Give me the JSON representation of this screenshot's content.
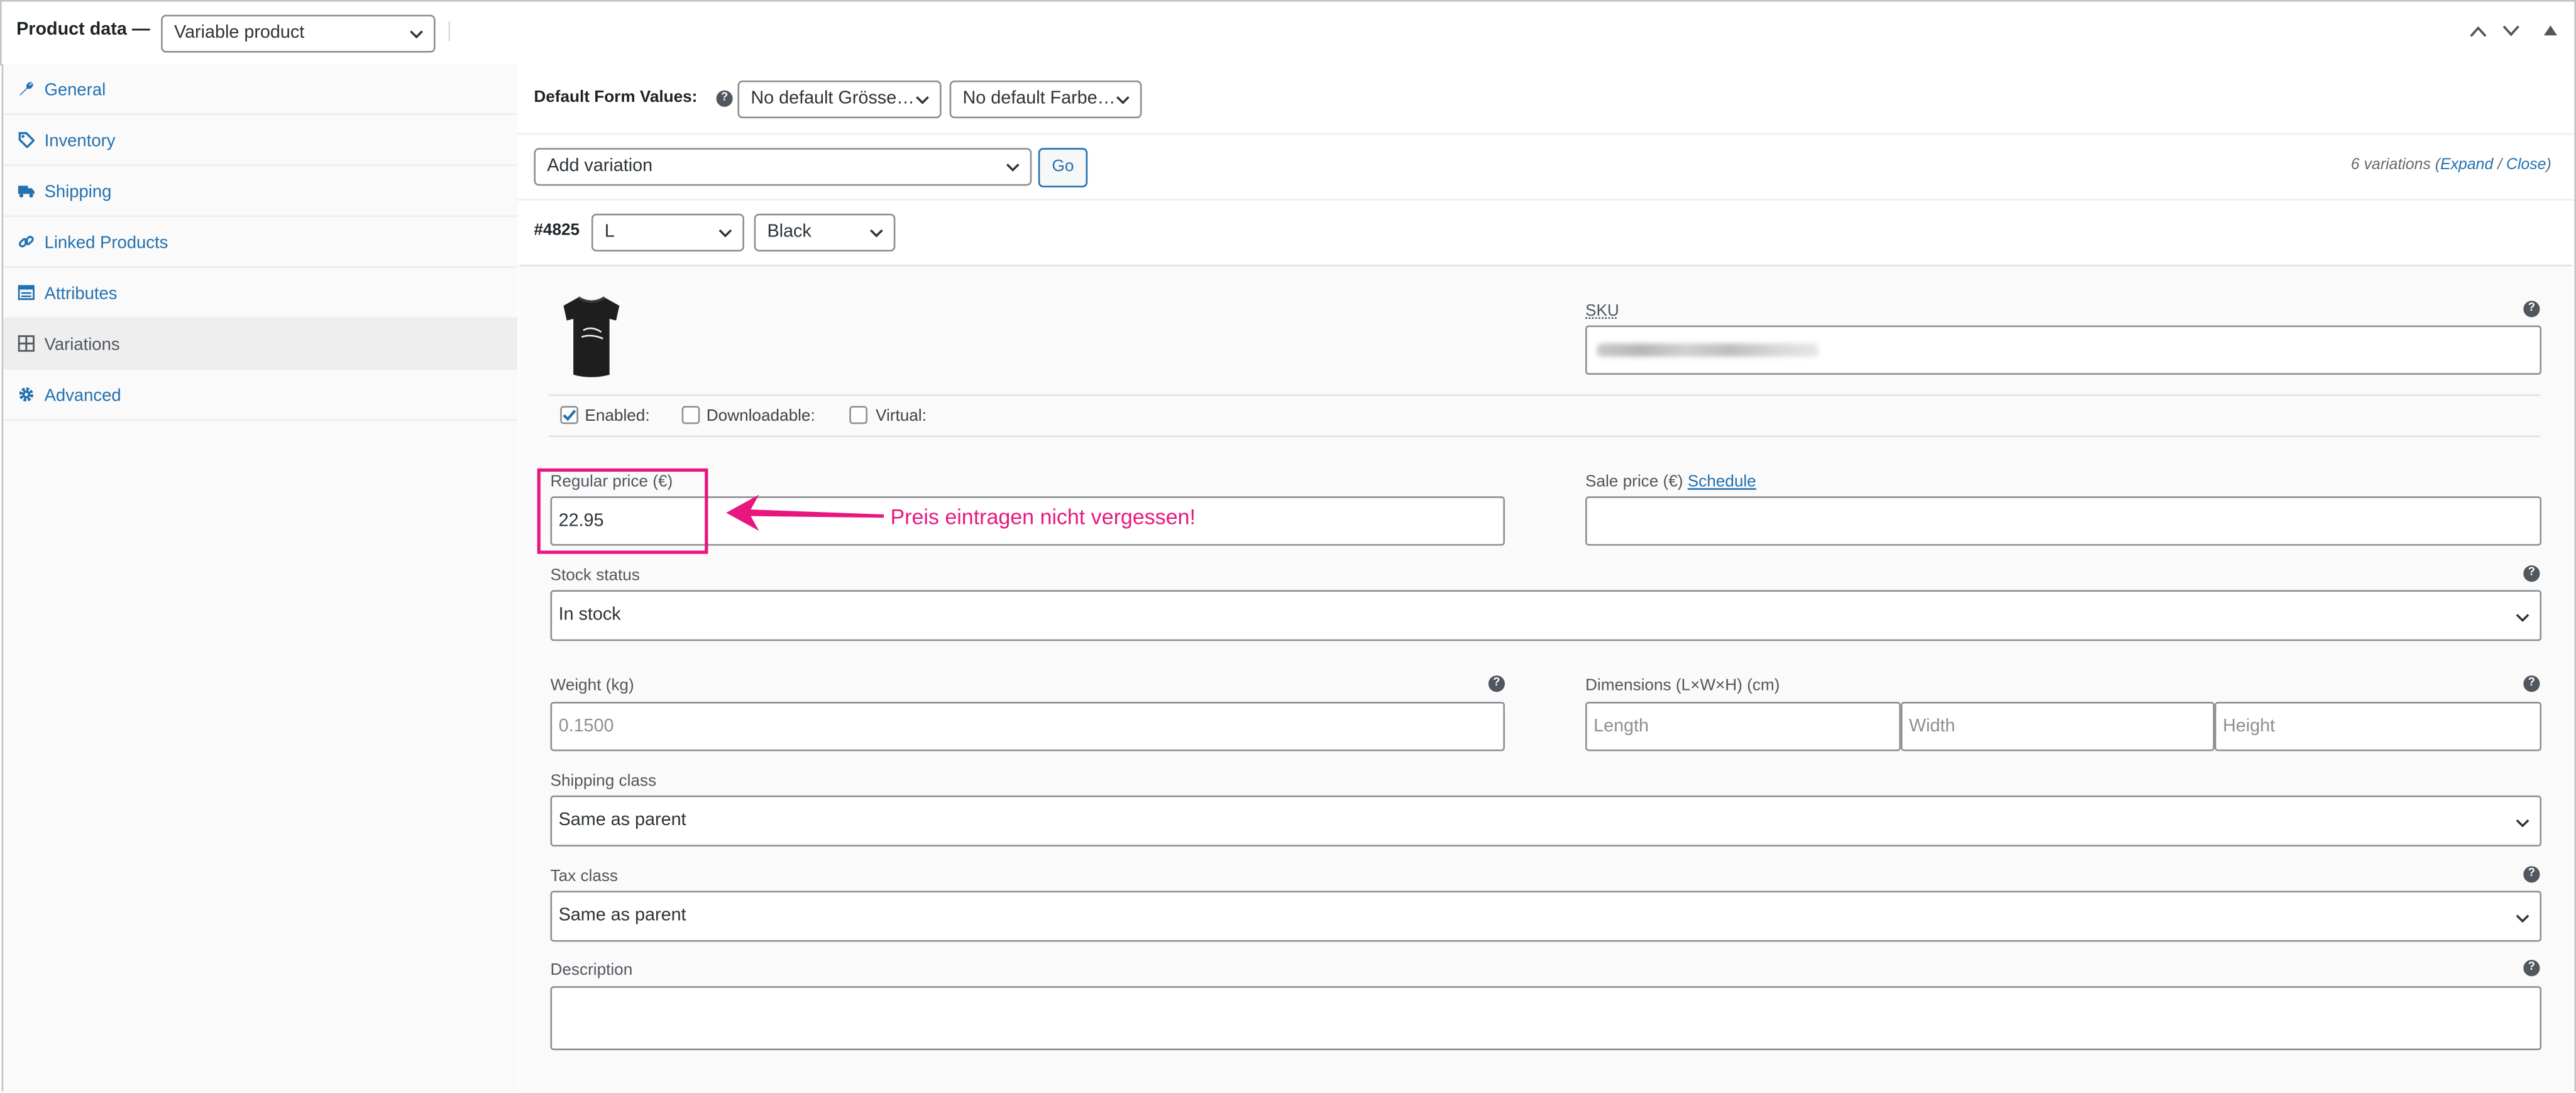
{
  "header": {
    "title": "Product data —",
    "product_type": "Variable product"
  },
  "sidebar": {
    "items": [
      {
        "label": "General",
        "icon": "wrench-icon"
      },
      {
        "label": "Inventory",
        "icon": "tag-icon"
      },
      {
        "label": "Shipping",
        "icon": "truck-icon"
      },
      {
        "label": "Linked Products",
        "icon": "link-icon"
      },
      {
        "label": "Attributes",
        "icon": "list-icon"
      },
      {
        "label": "Variations",
        "icon": "grid-icon",
        "active": true
      },
      {
        "label": "Advanced",
        "icon": "gear-icon"
      }
    ]
  },
  "defaults": {
    "label": "Default Form Values:",
    "size_select": "No default Grösse…",
    "color_select": "No default Farbe…"
  },
  "toolbar": {
    "add_variation": "Add variation",
    "go_label": "Go",
    "count_text": "6 variations (",
    "expand_label": "Expand",
    "slash": " / ",
    "close_label": "Close",
    "close_paren": ")"
  },
  "variation": {
    "id": "#4825",
    "size": "L",
    "color": "Black",
    "sku_label": "SKU",
    "enabled_label": "Enabled:",
    "downloadable_label": "Downloadable:",
    "virtual_label": "Virtual:",
    "enabled": true,
    "downloadable": false,
    "virtual": false,
    "regular_price_label": "Regular price (€)",
    "regular_price": "22.95",
    "sale_price_label": "Sale price (€)",
    "schedule_label": "Schedule",
    "sale_price": "",
    "stock_status_label": "Stock status",
    "stock_status": "In stock",
    "weight_label": "Weight (kg)",
    "weight_placeholder": "0.1500",
    "dimensions_label": "Dimensions (L×W×H) (cm)",
    "length_placeholder": "Length",
    "width_placeholder": "Width",
    "height_placeholder": "Height",
    "shipping_class_label": "Shipping class",
    "shipping_class": "Same as parent",
    "tax_class_label": "Tax class",
    "tax_class": "Same as parent",
    "description_label": "Description"
  },
  "annotation": {
    "text": "Preis eintragen nicht vergessen!",
    "color": "#e8177f"
  },
  "colors": {
    "link": "#2271b1",
    "annotation": "#e8177f",
    "border": "#8c8f94"
  }
}
